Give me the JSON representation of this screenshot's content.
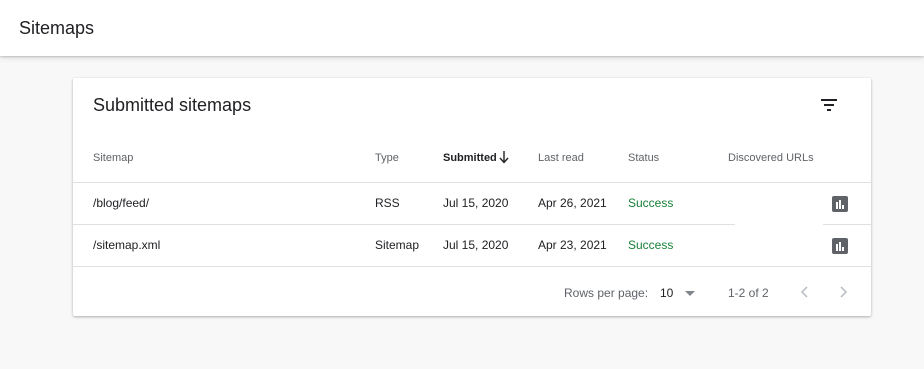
{
  "app": {
    "title": "Sitemaps"
  },
  "card": {
    "title": "Submitted sitemaps",
    "filter_icon": "filter-list-icon",
    "columns": {
      "sitemap": "Sitemap",
      "type": "Type",
      "submitted": "Submitted",
      "last_read": "Last read",
      "status": "Status",
      "discovered_urls": "Discovered URLs"
    },
    "sort": {
      "column": "Submitted",
      "direction": "descending"
    },
    "rows": [
      {
        "sitemap": "/blog/feed/",
        "type": "RSS",
        "submitted": "Jul 15, 2020",
        "last_read": "Apr 26, 2021",
        "status": "Success",
        "report_icon": "bar-chart-icon"
      },
      {
        "sitemap": "/sitemap.xml",
        "type": "Sitemap",
        "submitted": "Jul 15, 2020",
        "last_read": "Apr 23, 2021",
        "status": "Success",
        "report_icon": "bar-chart-icon"
      }
    ],
    "footer": {
      "rows_per_page_label": "Rows per page:",
      "rows_per_page_value": "10",
      "range": "1-2 of 2"
    }
  },
  "colors": {
    "status_success": "#188038",
    "icon_gray": "#5f6368",
    "background": "#f8f8f8"
  }
}
